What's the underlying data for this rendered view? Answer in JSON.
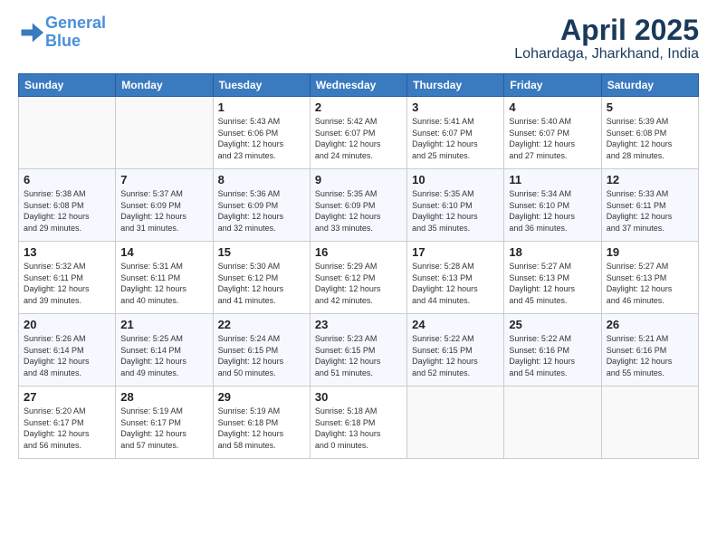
{
  "header": {
    "logo_line1": "General",
    "logo_line2": "Blue",
    "title": "April 2025",
    "subtitle": "Lohardaga, Jharkhand, India"
  },
  "weekdays": [
    "Sunday",
    "Monday",
    "Tuesday",
    "Wednesday",
    "Thursday",
    "Friday",
    "Saturday"
  ],
  "weeks": [
    [
      {
        "day": "",
        "sunrise": "",
        "sunset": "",
        "daylight": ""
      },
      {
        "day": "",
        "sunrise": "",
        "sunset": "",
        "daylight": ""
      },
      {
        "day": "1",
        "sunrise": "Sunrise: 5:43 AM",
        "sunset": "Sunset: 6:06 PM",
        "daylight": "Daylight: 12 hours and 23 minutes."
      },
      {
        "day": "2",
        "sunrise": "Sunrise: 5:42 AM",
        "sunset": "Sunset: 6:07 PM",
        "daylight": "Daylight: 12 hours and 24 minutes."
      },
      {
        "day": "3",
        "sunrise": "Sunrise: 5:41 AM",
        "sunset": "Sunset: 6:07 PM",
        "daylight": "Daylight: 12 hours and 25 minutes."
      },
      {
        "day": "4",
        "sunrise": "Sunrise: 5:40 AM",
        "sunset": "Sunset: 6:07 PM",
        "daylight": "Daylight: 12 hours and 27 minutes."
      },
      {
        "day": "5",
        "sunrise": "Sunrise: 5:39 AM",
        "sunset": "Sunset: 6:08 PM",
        "daylight": "Daylight: 12 hours and 28 minutes."
      }
    ],
    [
      {
        "day": "6",
        "sunrise": "Sunrise: 5:38 AM",
        "sunset": "Sunset: 6:08 PM",
        "daylight": "Daylight: 12 hours and 29 minutes."
      },
      {
        "day": "7",
        "sunrise": "Sunrise: 5:37 AM",
        "sunset": "Sunset: 6:09 PM",
        "daylight": "Daylight: 12 hours and 31 minutes."
      },
      {
        "day": "8",
        "sunrise": "Sunrise: 5:36 AM",
        "sunset": "Sunset: 6:09 PM",
        "daylight": "Daylight: 12 hours and 32 minutes."
      },
      {
        "day": "9",
        "sunrise": "Sunrise: 5:35 AM",
        "sunset": "Sunset: 6:09 PM",
        "daylight": "Daylight: 12 hours and 33 minutes."
      },
      {
        "day": "10",
        "sunrise": "Sunrise: 5:35 AM",
        "sunset": "Sunset: 6:10 PM",
        "daylight": "Daylight: 12 hours and 35 minutes."
      },
      {
        "day": "11",
        "sunrise": "Sunrise: 5:34 AM",
        "sunset": "Sunset: 6:10 PM",
        "daylight": "Daylight: 12 hours and 36 minutes."
      },
      {
        "day": "12",
        "sunrise": "Sunrise: 5:33 AM",
        "sunset": "Sunset: 6:11 PM",
        "daylight": "Daylight: 12 hours and 37 minutes."
      }
    ],
    [
      {
        "day": "13",
        "sunrise": "Sunrise: 5:32 AM",
        "sunset": "Sunset: 6:11 PM",
        "daylight": "Daylight: 12 hours and 39 minutes."
      },
      {
        "day": "14",
        "sunrise": "Sunrise: 5:31 AM",
        "sunset": "Sunset: 6:11 PM",
        "daylight": "Daylight: 12 hours and 40 minutes."
      },
      {
        "day": "15",
        "sunrise": "Sunrise: 5:30 AM",
        "sunset": "Sunset: 6:12 PM",
        "daylight": "Daylight: 12 hours and 41 minutes."
      },
      {
        "day": "16",
        "sunrise": "Sunrise: 5:29 AM",
        "sunset": "Sunset: 6:12 PM",
        "daylight": "Daylight: 12 hours and 42 minutes."
      },
      {
        "day": "17",
        "sunrise": "Sunrise: 5:28 AM",
        "sunset": "Sunset: 6:13 PM",
        "daylight": "Daylight: 12 hours and 44 minutes."
      },
      {
        "day": "18",
        "sunrise": "Sunrise: 5:27 AM",
        "sunset": "Sunset: 6:13 PM",
        "daylight": "Daylight: 12 hours and 45 minutes."
      },
      {
        "day": "19",
        "sunrise": "Sunrise: 5:27 AM",
        "sunset": "Sunset: 6:13 PM",
        "daylight": "Daylight: 12 hours and 46 minutes."
      }
    ],
    [
      {
        "day": "20",
        "sunrise": "Sunrise: 5:26 AM",
        "sunset": "Sunset: 6:14 PM",
        "daylight": "Daylight: 12 hours and 48 minutes."
      },
      {
        "day": "21",
        "sunrise": "Sunrise: 5:25 AM",
        "sunset": "Sunset: 6:14 PM",
        "daylight": "Daylight: 12 hours and 49 minutes."
      },
      {
        "day": "22",
        "sunrise": "Sunrise: 5:24 AM",
        "sunset": "Sunset: 6:15 PM",
        "daylight": "Daylight: 12 hours and 50 minutes."
      },
      {
        "day": "23",
        "sunrise": "Sunrise: 5:23 AM",
        "sunset": "Sunset: 6:15 PM",
        "daylight": "Daylight: 12 hours and 51 minutes."
      },
      {
        "day": "24",
        "sunrise": "Sunrise: 5:22 AM",
        "sunset": "Sunset: 6:15 PM",
        "daylight": "Daylight: 12 hours and 52 minutes."
      },
      {
        "day": "25",
        "sunrise": "Sunrise: 5:22 AM",
        "sunset": "Sunset: 6:16 PM",
        "daylight": "Daylight: 12 hours and 54 minutes."
      },
      {
        "day": "26",
        "sunrise": "Sunrise: 5:21 AM",
        "sunset": "Sunset: 6:16 PM",
        "daylight": "Daylight: 12 hours and 55 minutes."
      }
    ],
    [
      {
        "day": "27",
        "sunrise": "Sunrise: 5:20 AM",
        "sunset": "Sunset: 6:17 PM",
        "daylight": "Daylight: 12 hours and 56 minutes."
      },
      {
        "day": "28",
        "sunrise": "Sunrise: 5:19 AM",
        "sunset": "Sunset: 6:17 PM",
        "daylight": "Daylight: 12 hours and 57 minutes."
      },
      {
        "day": "29",
        "sunrise": "Sunrise: 5:19 AM",
        "sunset": "Sunset: 6:18 PM",
        "daylight": "Daylight: 12 hours and 58 minutes."
      },
      {
        "day": "30",
        "sunrise": "Sunrise: 5:18 AM",
        "sunset": "Sunset: 6:18 PM",
        "daylight": "Daylight: 13 hours and 0 minutes."
      },
      {
        "day": "",
        "sunrise": "",
        "sunset": "",
        "daylight": ""
      },
      {
        "day": "",
        "sunrise": "",
        "sunset": "",
        "daylight": ""
      },
      {
        "day": "",
        "sunrise": "",
        "sunset": "",
        "daylight": ""
      }
    ]
  ]
}
